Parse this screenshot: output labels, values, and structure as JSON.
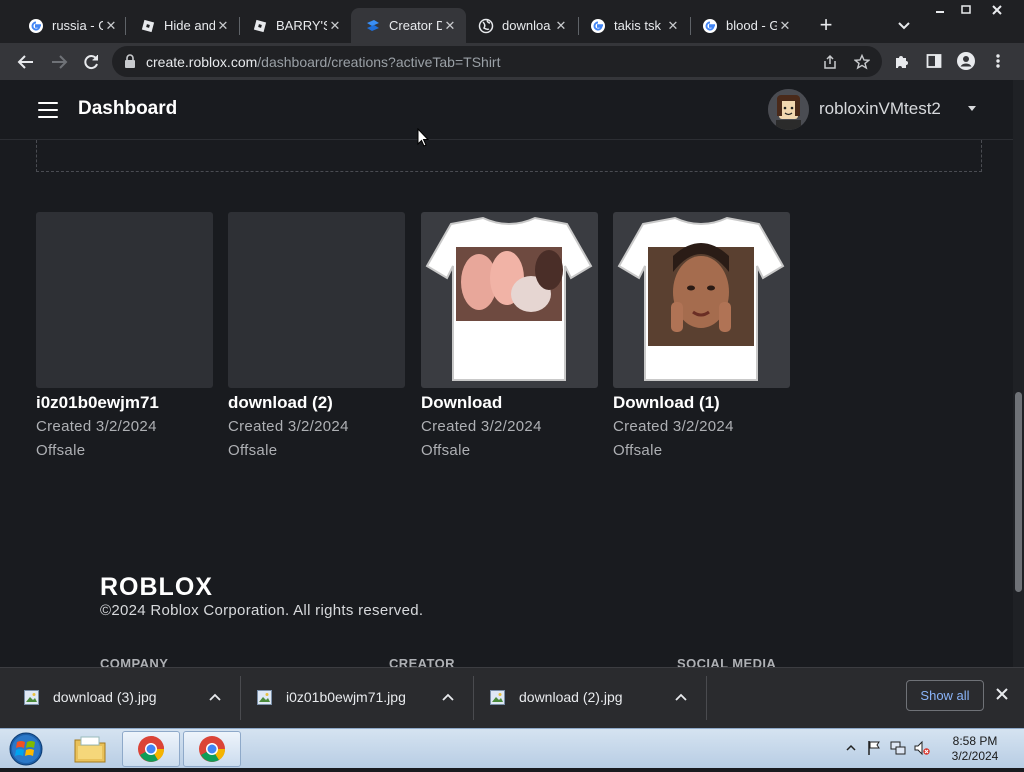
{
  "browser": {
    "tabs": [
      {
        "title": "russia - G",
        "favicon": "google-icon"
      },
      {
        "title": "Hide and",
        "favicon": "roblox-icon"
      },
      {
        "title": "BARRY'S",
        "favicon": "roblox-icon"
      },
      {
        "title": "Creator D",
        "favicon": "roblox-studio-icon",
        "active": true
      },
      {
        "title": "downloa",
        "favicon": "globe-icon"
      },
      {
        "title": "takis tsk",
        "favicon": "google-icon"
      },
      {
        "title": "blood - G",
        "favicon": "google-icon"
      }
    ],
    "url_host": "create.roblox.com",
    "url_path": "/dashboard/creations?activeTab=TShirt"
  },
  "dashboard": {
    "title": "Dashboard",
    "username": "robloxinVMtest2"
  },
  "creations": [
    {
      "name": "i0z01b0ewjm71",
      "created": "Created 3/2/2024",
      "status": "Offsale",
      "thumbnail": "placeholder"
    },
    {
      "name": "download (2)",
      "created": "Created 3/2/2024",
      "status": "Offsale",
      "thumbnail": "placeholder"
    },
    {
      "name": "Download",
      "created": "Created 3/2/2024",
      "status": "Offsale",
      "thumbnail": "tshirt-image"
    },
    {
      "name": "Download (1)",
      "created": "Created 3/2/2024",
      "status": "Offsale",
      "thumbnail": "tshirt-portrait"
    }
  ],
  "footer": {
    "logo": "ROBLOX",
    "copyright": "©2024 Roblox Corporation. All rights reserved.",
    "columns": [
      "COMPANY",
      "CREATOR",
      "SOCIAL MEDIA"
    ]
  },
  "downloads": {
    "items": [
      "download (3).jpg",
      "i0z01b0ewjm71.jpg",
      "download (2).jpg"
    ],
    "show_all": "Show all"
  },
  "taskbar": {
    "time": "8:58 PM",
    "date": "3/2/2024"
  },
  "colors": {
    "page_bg": "#191b1f",
    "tab_active": "#35363a",
    "link_blue": "#8ab4f8"
  }
}
